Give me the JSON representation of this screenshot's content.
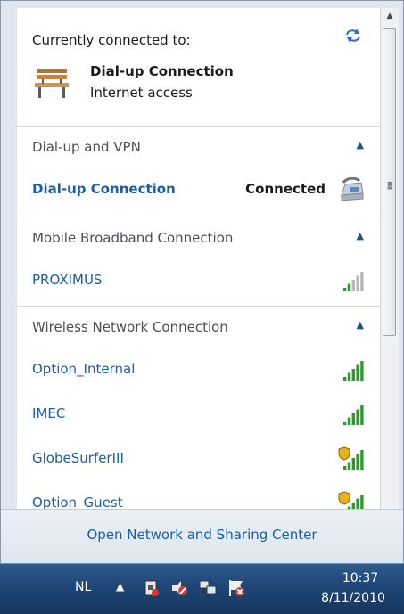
{
  "current": {
    "title": "Currently connected to:",
    "connection_name": "Dial-up Connection",
    "connection_status": "Internet access"
  },
  "sections": [
    {
      "label": "Dial-up and VPN",
      "items": [
        {
          "name": "Dial-up Connection",
          "status": "Connected",
          "icon": "telephone-modem-icon"
        }
      ]
    },
    {
      "label": "Mobile Broadband Connection",
      "items": [
        {
          "name": "PROXIMUS",
          "signal_bars": 2,
          "icon": "signal-strength-icon"
        }
      ]
    },
    {
      "label": "Wireless Network Connection",
      "items": [
        {
          "name": "Option_Internal",
          "signal_bars": 5,
          "secured": false
        },
        {
          "name": "IMEC",
          "signal_bars": 5,
          "secured": false
        },
        {
          "name": "GlobeSurferIII",
          "signal_bars": 5,
          "secured": true
        },
        {
          "name": "Option_Guest",
          "signal_bars": 5,
          "secured": true
        }
      ]
    }
  ],
  "footer": {
    "link": "Open Network and Sharing Center"
  },
  "taskbar": {
    "language": "NL",
    "time": "10:37",
    "date": "8/11/2010"
  },
  "colors": {
    "link": "#1a5ea8",
    "signal_on": "#2c9a2c",
    "signal_off": "#b8b8b8",
    "taskbar": "#1e4676"
  }
}
